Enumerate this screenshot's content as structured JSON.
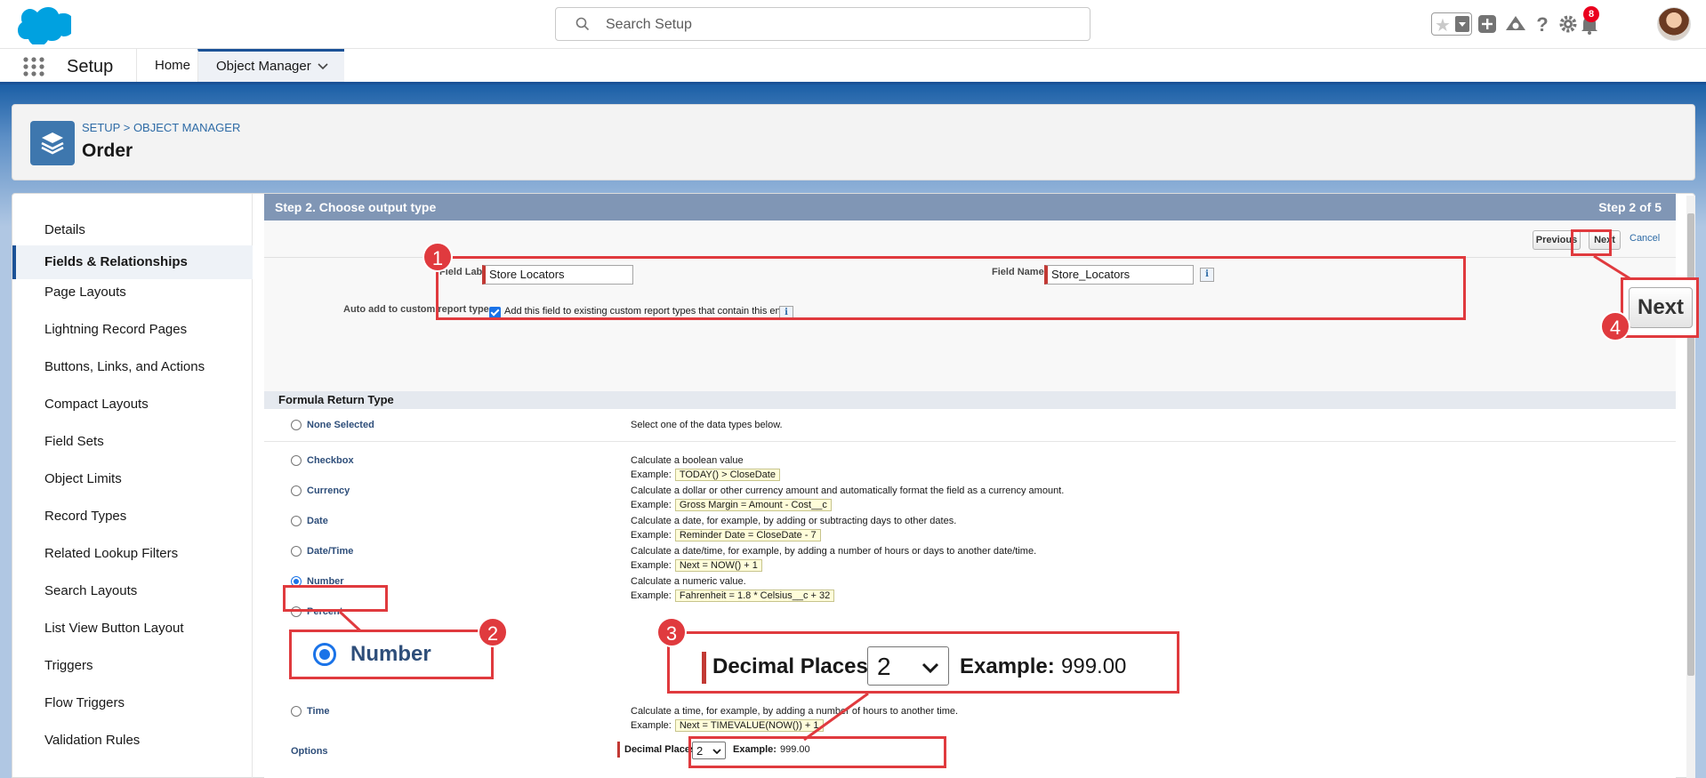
{
  "header": {
    "search_placeholder": "Search Setup",
    "notification_count": "8"
  },
  "context_bar": {
    "app_name": "Setup",
    "tabs": [
      {
        "label": "Home"
      },
      {
        "label": "Object Manager"
      }
    ]
  },
  "page_header": {
    "breadcrumb_setup": "SETUP",
    "breadcrumb_sep": " > ",
    "breadcrumb_om": "OBJECT MANAGER",
    "title": "Order"
  },
  "sidebar": {
    "items": [
      {
        "label": "Details"
      },
      {
        "label": "Fields & Relationships",
        "active": true
      },
      {
        "label": "Page Layouts"
      },
      {
        "label": "Lightning Record Pages"
      },
      {
        "label": "Buttons, Links, and Actions"
      },
      {
        "label": "Compact Layouts"
      },
      {
        "label": "Field Sets"
      },
      {
        "label": "Object Limits"
      },
      {
        "label": "Record Types"
      },
      {
        "label": "Related Lookup Filters"
      },
      {
        "label": "Search Layouts"
      },
      {
        "label": "List View Button Layout"
      },
      {
        "label": "Triggers"
      },
      {
        "label": "Flow Triggers"
      },
      {
        "label": "Validation Rules"
      }
    ]
  },
  "step": {
    "title": "Step 2. Choose output type",
    "progress": "Step 2 of 5",
    "previous_label": "Previous",
    "next_label": "Next",
    "cancel_label": "Cancel"
  },
  "fields": {
    "field_label_label": "Field Label",
    "field_label_value": "Store Locators",
    "field_name_label": "Field Name",
    "field_name_value": "Store_Locators",
    "info_glyph": "i",
    "auto_add_label": "Auto add to custom report type",
    "auto_add_text": "Add this field to existing custom report types that contain this entity"
  },
  "formula": {
    "section_title": "Formula Return Type",
    "example_prefix": "Example:",
    "types": [
      {
        "label": "None Selected",
        "desc": "Select one of the data types below.",
        "example": ""
      },
      {
        "label": "Checkbox",
        "desc": "Calculate a boolean value",
        "example": "TODAY() > CloseDate"
      },
      {
        "label": "Currency",
        "desc": "Calculate a dollar or other currency amount and automatically format the field as a currency amount.",
        "example": "Gross Margin = Amount - Cost__c"
      },
      {
        "label": "Date",
        "desc": "Calculate a date, for example, by adding or subtracting days to other dates.",
        "example": "Reminder Date = CloseDate - 7"
      },
      {
        "label": "Date/Time",
        "desc": "Calculate a date/time, for example, by adding a number of hours or days to another date/time.",
        "example": "Next = NOW() + 1"
      },
      {
        "label": "Number",
        "desc": "Calculate a numeric value.",
        "example": "Fahrenheit = 1.8 * Celsius__c + 32",
        "selected": true
      },
      {
        "label": "Percent",
        "desc": "",
        "example": ""
      },
      {
        "label": "Time",
        "desc": "Calculate a time, for example, by adding a number of hours to another time.",
        "example": "Next = TIMEVALUE(NOW()) + 1"
      }
    ],
    "options_label": "Options",
    "decimal_places_label": "Decimal Places",
    "decimal_places_value": "2",
    "example_label": "Example:",
    "example_value": "999.00"
  },
  "annotations": {
    "callouts": [
      "1",
      "2",
      "3",
      "4"
    ],
    "zoom_number_label": "Number",
    "zoom_next_label": "Next"
  },
  "colors": {
    "brand": "#0176d3",
    "annotation_red": "#e03a3e",
    "step_header": "#8096b5"
  }
}
